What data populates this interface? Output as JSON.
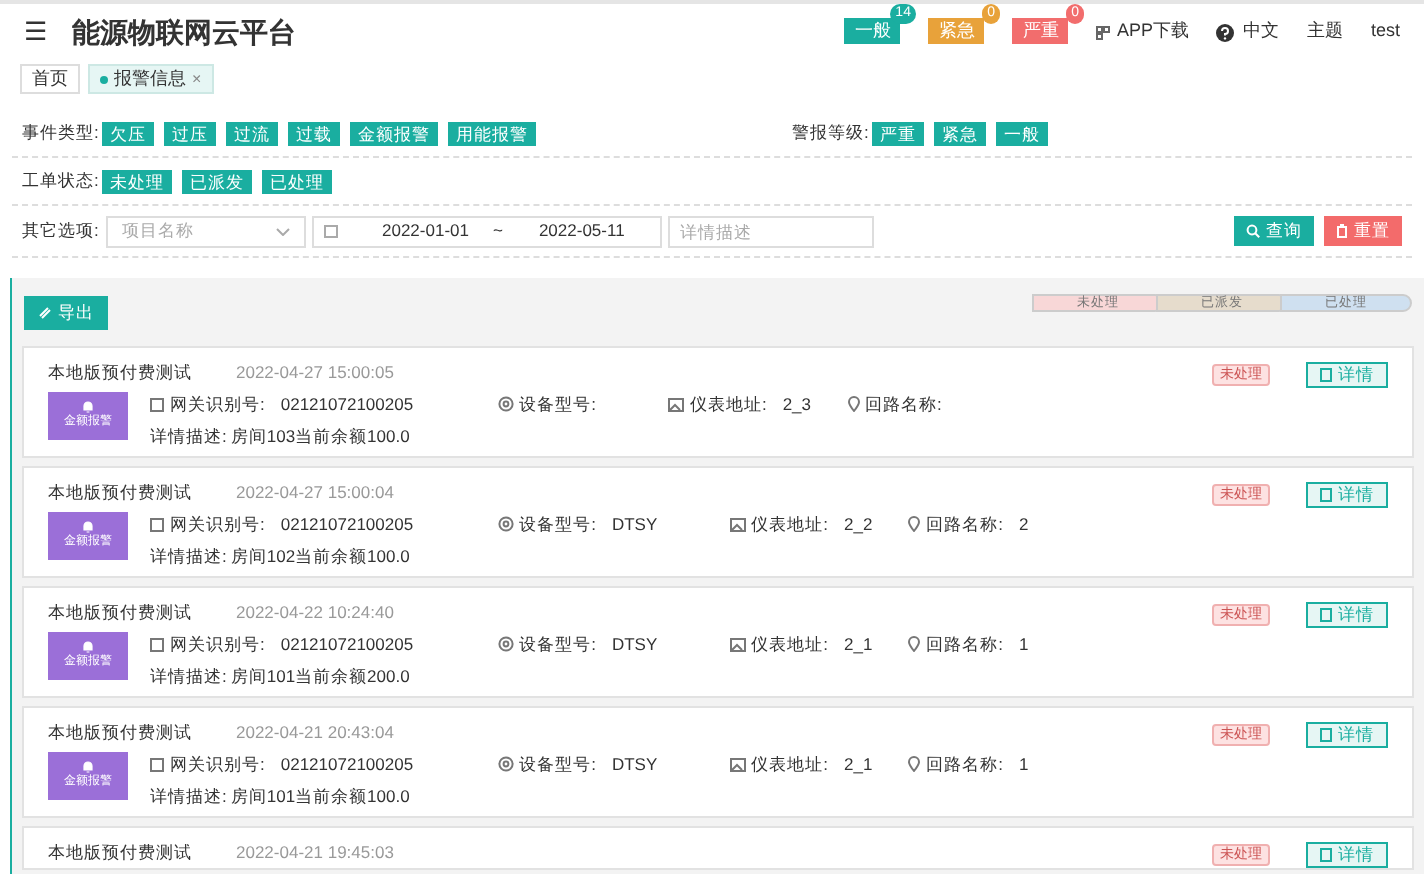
{
  "header": {
    "menu_icon": "☰",
    "title": "能源物联网云平台",
    "alarm_counts": [
      {
        "label": "一般",
        "count": "14",
        "color": "#1aaea0"
      },
      {
        "label": "紧急",
        "count": "0",
        "color": "#e8a23a"
      },
      {
        "label": "严重",
        "count": "0",
        "color": "#f26d6d"
      }
    ],
    "links": [
      "APP下载",
      "中文",
      "主题",
      "test"
    ]
  },
  "tabs": [
    {
      "label": "首页",
      "selected": false
    },
    {
      "label": "报警信息",
      "selected": true,
      "close": "×"
    }
  ],
  "filters": {
    "event_type": {
      "label": "事件类型:",
      "options": [
        "欠压",
        "过压",
        "过流",
        "过载",
        "金额报警",
        "用能报警"
      ]
    },
    "alarm_level": {
      "label": "警报等级:",
      "options": [
        "严重",
        "紧急",
        "一般"
      ]
    },
    "order_status": {
      "label": "工单状态:",
      "options": [
        "未处理",
        "已派发",
        "已处理"
      ]
    },
    "other": {
      "label": "其它选项:",
      "project_placeholder": "项目名称",
      "date_start": "2022-01-01",
      "date_sep": "~",
      "date_end": "2022-05-11",
      "detail_placeholder": "详情描述"
    },
    "search_button": "查询",
    "reset_button": "重置"
  },
  "toolbar": {
    "export_button": "导出",
    "legend": [
      {
        "label": "未处理",
        "color": "#f8d7d7"
      },
      {
        "label": "已派发",
        "color": "#e6dccc"
      },
      {
        "label": "已处理",
        "color": "#cfe0f0"
      }
    ]
  },
  "records": [
    {
      "title": "本地版预付费测试",
      "time": "2022-04-27 15:00:05",
      "badge": "金额报警",
      "gateway_label": "网关识别号:",
      "gateway": "02121072100205",
      "device_label": "设备型号:",
      "meter_label": "仪表地址:",
      "meter": "2_3",
      "loop_label": "回路名称:",
      "desc_label": "详情描述:",
      "desc": "房间103当前余额100.0",
      "status": "未处理",
      "detail_button": "详情"
    },
    {
      "title": "本地版预付费测试",
      "time": "2022-04-27 15:00:04",
      "badge": "金额报警",
      "gateway_label": "网关识别号:",
      "gateway": "02121072100205",
      "device_label": "设备型号:",
      "device": "DTSY",
      "meter_label": "仪表地址:",
      "meter": "2_2",
      "loop_label": "回路名称:",
      "loop": "2",
      "desc_label": "详情描述:",
      "desc": "房间102当前余额100.0",
      "status": "未处理",
      "detail_button": "详情"
    },
    {
      "title": "本地版预付费测试",
      "time": "2022-04-22 10:24:40",
      "badge": "金额报警",
      "gateway_label": "网关识别号:",
      "gateway": "02121072100205",
      "device_label": "设备型号:",
      "device": "DTSY",
      "meter_label": "仪表地址:",
      "meter": "2_1",
      "loop_label": "回路名称:",
      "loop": "1",
      "desc_label": "详情描述:",
      "desc": "房间101当前余额200.0",
      "status": "未处理",
      "detail_button": "详情"
    },
    {
      "title": "本地版预付费测试",
      "time": "2022-04-21 20:43:04",
      "badge": "金额报警",
      "gateway_label": "网关识别号:",
      "gateway": "02121072100205",
      "device_label": "设备型号:",
      "device": "DTSY",
      "meter_label": "仪表地址:",
      "meter": "2_1",
      "loop_label": "回路名称:",
      "loop": "1",
      "desc_label": "详情描述:",
      "desc": "房间101当前余额100.0",
      "status": "未处理",
      "detail_button": "详情"
    },
    {
      "title": "本地版预付费测试",
      "time": "2022-04-21 19:45:03",
      "status": "未处理",
      "detail_button": "详情"
    }
  ]
}
